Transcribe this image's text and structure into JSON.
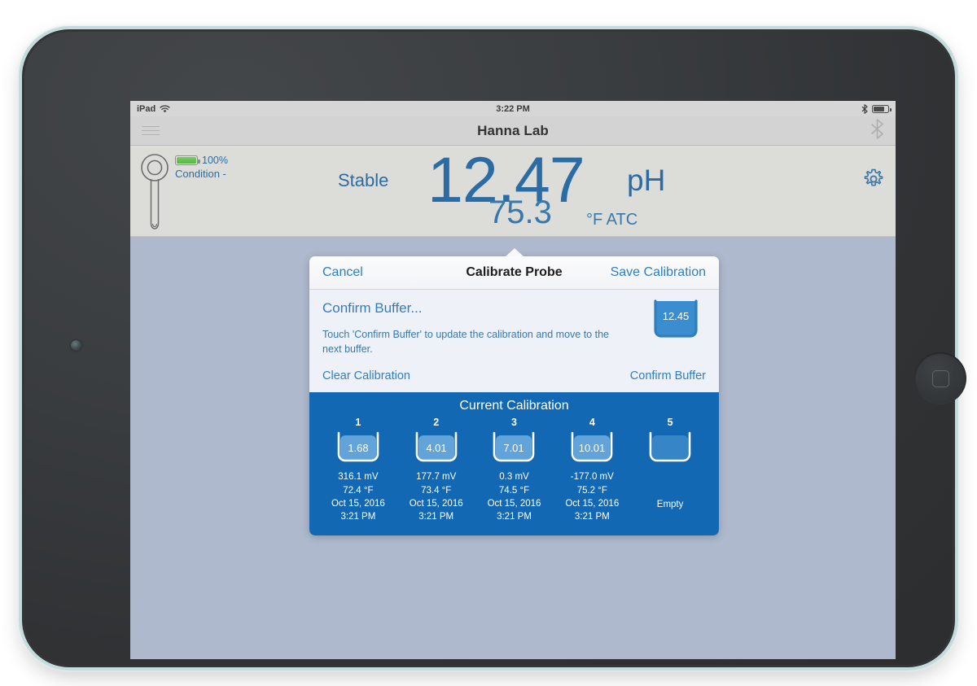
{
  "status_bar": {
    "device_label": "iPad",
    "wifi_icon": "wifi-icon",
    "time": "3:22 PM",
    "bluetooth_icon": "bluetooth-icon",
    "battery_icon": "battery-icon"
  },
  "nav_bar": {
    "menu_icon": "hamburger-menu-icon",
    "title": "Hanna Lab",
    "bluetooth_icon": "bluetooth-icon"
  },
  "reading": {
    "probe_icon": "ph-probe-icon",
    "battery_percent": "100%",
    "condition": "Condition -",
    "stability": "Stable",
    "value": "12.47",
    "unit": "pH",
    "temperature": "75.3",
    "temperature_unit": "°F ATC",
    "settings_icon": "gear-icon"
  },
  "dialog": {
    "cancel_label": "Cancel",
    "title": "Calibrate Probe",
    "save_label": "Save Calibration",
    "heading": "Confirm Buffer...",
    "description": "Touch 'Confirm Buffer' to update the calibration and move to the next buffer.",
    "current_beaker_value": "12.45",
    "clear_label": "Clear Calibration",
    "confirm_label": "Confirm Buffer"
  },
  "calibration": {
    "title": "Current Calibration",
    "empty_label": "Empty",
    "buffers": [
      {
        "index": "1",
        "value": "1.68",
        "mv": "316.1 mV",
        "temp": "72.4 °F",
        "date": "Oct 15, 2016",
        "time": "3:21 PM",
        "filled": true
      },
      {
        "index": "2",
        "value": "4.01",
        "mv": "177.7 mV",
        "temp": "73.4 °F",
        "date": "Oct 15, 2016",
        "time": "3:21 PM",
        "filled": true
      },
      {
        "index": "3",
        "value": "7.01",
        "mv": "0.3 mV",
        "temp": "74.5 °F",
        "date": "Oct 15, 2016",
        "time": "3:21 PM",
        "filled": true
      },
      {
        "index": "4",
        "value": "10.01",
        "mv": "-177.0 mV",
        "temp": "75.2 °F",
        "date": "Oct 15, 2016",
        "time": "3:21 PM",
        "filled": true
      },
      {
        "index": "5",
        "value": "",
        "mv": "",
        "temp": "",
        "date": "",
        "time": "",
        "filled": false
      }
    ]
  },
  "colors": {
    "accent_blue": "#2f7fc0",
    "reading_blue": "#2b6ca4",
    "panel_blue": "#1268b3",
    "screen_background": "#aeb9cd",
    "battery_green": "#54b741"
  }
}
